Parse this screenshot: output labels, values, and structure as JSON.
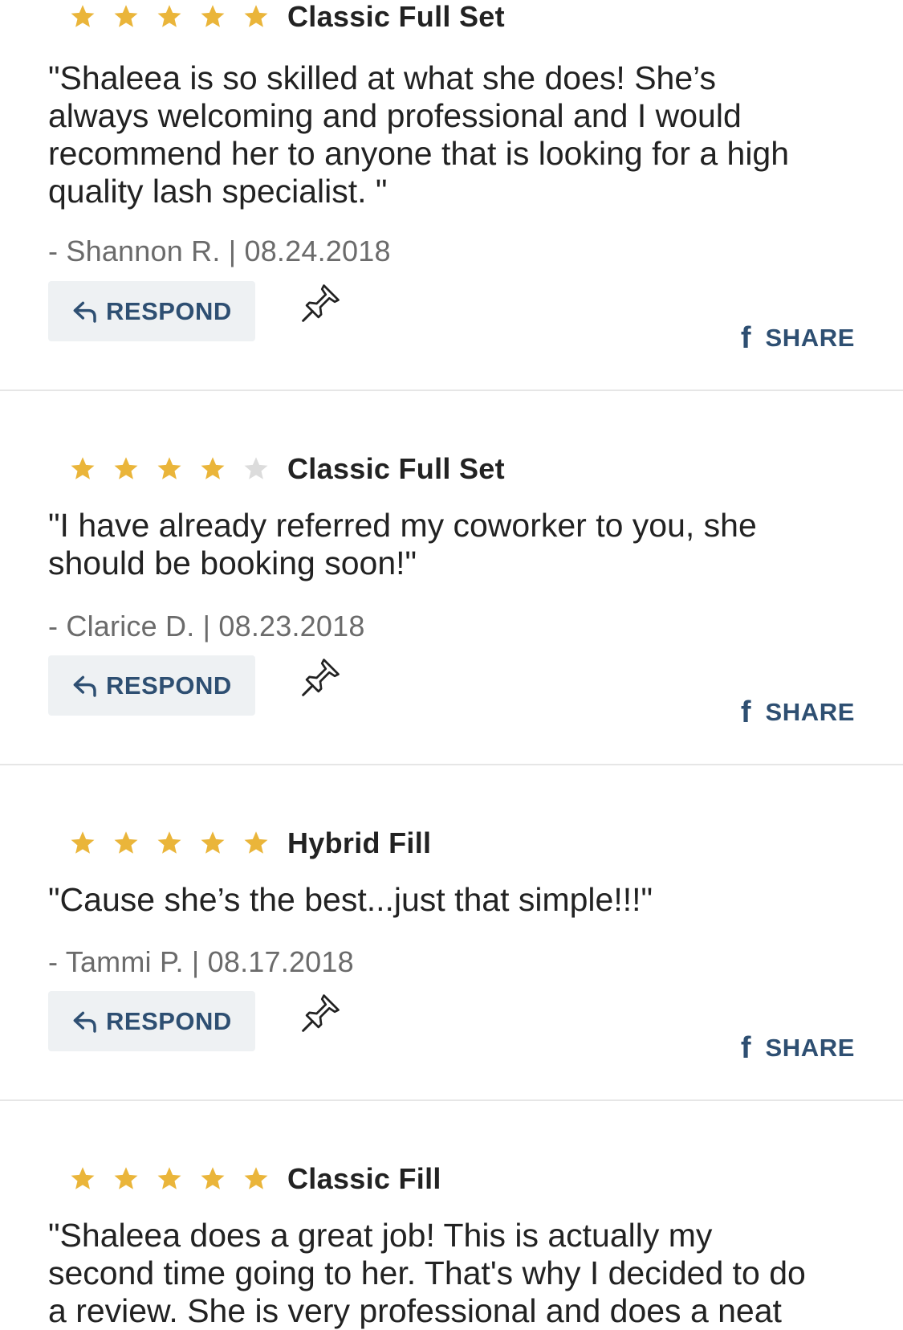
{
  "colors": {
    "star_filled": "#eab53a",
    "star_empty": "#dcdcdc",
    "accent": "#2e4f72",
    "button_bg": "#eef1f3",
    "divider": "#e6e6e6"
  },
  "icons": {
    "star": "star-icon",
    "respond": "reply-arrow-icon",
    "pin": "pushpin-icon",
    "share": "facebook-icon"
  },
  "reviews": [
    {
      "rating": 5,
      "service": "Classic Full Set",
      "quote_lines": [
        "\"Shaleea is so skilled at what she does! She’s",
        "always welcoming and professional and I would",
        "recommend her to anyone that is looking for a high",
        "quality lash specialist. \""
      ],
      "author": "- Shannon R. | 08.24.2018",
      "respond_label": "RESPOND",
      "share_label": "SHARE",
      "fb_glyph": "f"
    },
    {
      "rating": 4,
      "service": "Classic Full Set",
      "quote_lines": [
        "\"I have already referred my coworker to you, she",
        "should be booking soon!\""
      ],
      "author": "- Clarice D. | 08.23.2018",
      "respond_label": "RESPOND",
      "share_label": "SHARE",
      "fb_glyph": "f"
    },
    {
      "rating": 5,
      "service": "Hybrid Fill",
      "quote_lines": [
        "\"Cause she’s the best...just that simple!!!\""
      ],
      "author": "- Tammi P. | 08.17.2018",
      "respond_label": "RESPOND",
      "share_label": "SHARE",
      "fb_glyph": "f"
    },
    {
      "rating": 5,
      "service": "Classic Fill",
      "quote_lines": [
        "\"Shaleea does a great job! This is actually my",
        "second time going to her. That's why I decided to do",
        "a review. She is very professional and does a neat"
      ],
      "author": "",
      "respond_label": "",
      "share_label": "",
      "fb_glyph": ""
    }
  ]
}
